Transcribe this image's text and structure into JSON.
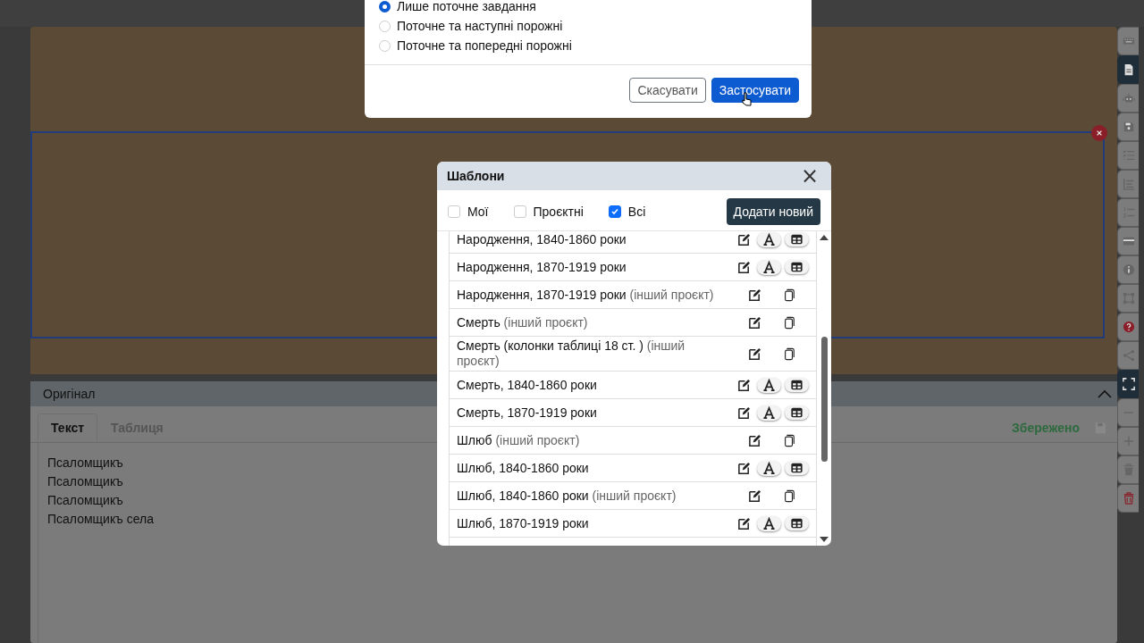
{
  "fill_options": {
    "options": [
      {
        "label": "Лише поточне завдання",
        "selected": true
      },
      {
        "label": "Поточне та наступні порожні",
        "selected": false
      },
      {
        "label": "Поточне та попередні порожні",
        "selected": false
      }
    ],
    "buttons": [
      {
        "label": "Скасувати",
        "kind": "secondary"
      },
      {
        "label": "Застосувати",
        "kind": "primary"
      }
    ]
  },
  "templates_dialog": {
    "title": "Шаблони",
    "close": "×",
    "filters": [
      {
        "label": "Мої",
        "checked": false
      },
      {
        "label": "Проєктні",
        "checked": false
      },
      {
        "label": "Всі",
        "checked": true
      }
    ],
    "add_button": "Додати новий",
    "items": [
      {
        "name": "Народження, 1840-1860 роки",
        "kind": "own"
      },
      {
        "name": "Народження, 1870-1919 роки",
        "kind": "own"
      },
      {
        "name": "Народження, 1870-1919 роки",
        "note": "(інший проєкт)",
        "kind": "other"
      },
      {
        "name": "Смерть",
        "note": "(інший проєкт)",
        "kind": "other"
      },
      {
        "name": "Смерть (колонки таблиці 18 ст. )",
        "note": "(інший проєкт)",
        "kind": "other"
      },
      {
        "name": "Смерть, 1840-1860 роки",
        "kind": "own"
      },
      {
        "name": "Смерть, 1870-1919 роки",
        "kind": "own"
      },
      {
        "name": "Шлюб",
        "note": "(інший проєкт)",
        "kind": "other"
      },
      {
        "name": "Шлюб, 1840-1860 роки",
        "kind": "own"
      },
      {
        "name": "Шлюб, 1840-1860 роки",
        "note": "(інший проєкт)",
        "kind": "other"
      },
      {
        "name": "Шлюб, 1870-1919 роки",
        "kind": "own"
      }
    ]
  },
  "original_panel": {
    "title": "Оригінал",
    "tabs": [
      {
        "label": "Текст",
        "selected": true
      },
      {
        "label": "Таблиця",
        "selected": false
      }
    ],
    "status": "Збережено",
    "lines": [
      "Псаломщикъ",
      "Псаломщикъ",
      "Псаломщикъ",
      "Псаломщикъ села"
    ]
  },
  "sidebar": {
    "items": [
      {
        "kind": "keyboard",
        "selected": false
      },
      {
        "kind": "file",
        "selected": true
      },
      {
        "kind": "robot",
        "selected": false
      },
      {
        "kind": "save",
        "selected": false
      },
      {
        "kind": "checklist",
        "selected": false
      },
      {
        "kind": "lines",
        "selected": false
      },
      {
        "kind": "numbered",
        "selected": false
      },
      {
        "kind": "card",
        "selected": false
      },
      {
        "kind": "info",
        "selected": false
      },
      {
        "kind": "crop",
        "selected": false
      },
      {
        "kind": "help",
        "selected": false
      },
      {
        "kind": "share",
        "selected": false
      },
      {
        "kind": "fullscreen",
        "selected": true
      },
      {
        "kind": "minus",
        "selected": false
      },
      {
        "kind": "plus",
        "selected": false
      },
      {
        "kind": "trash",
        "selected": false
      },
      {
        "kind": "trash-red",
        "selected": false
      }
    ]
  }
}
